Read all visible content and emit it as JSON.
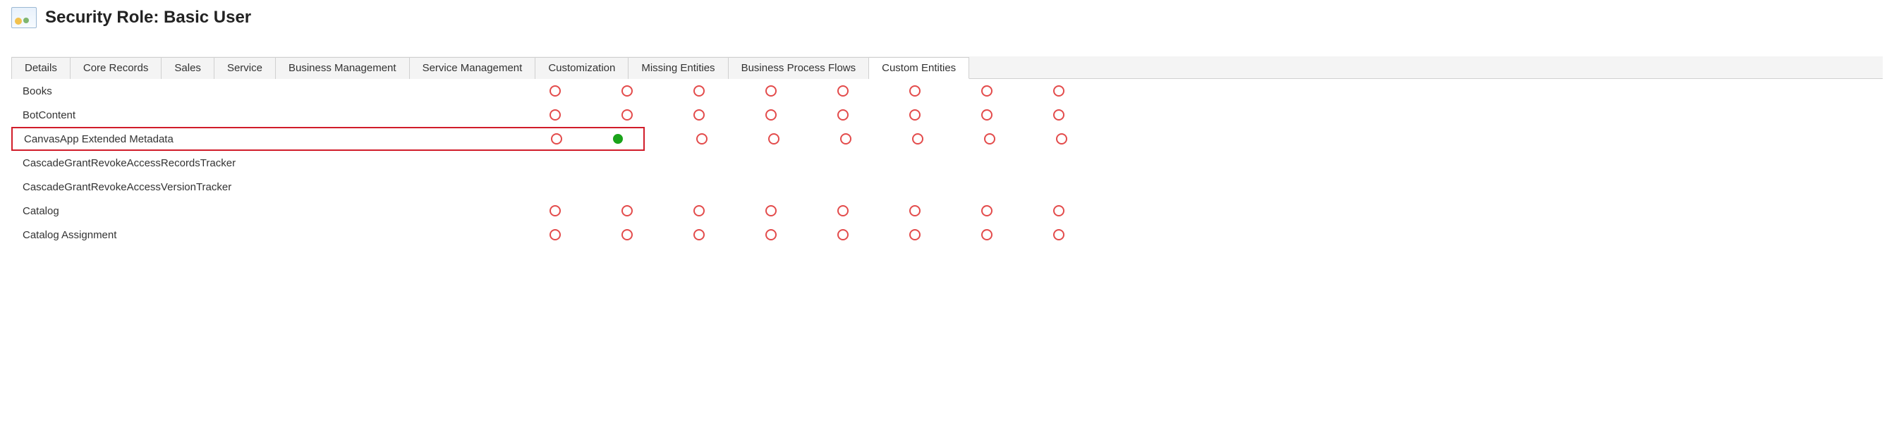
{
  "header": {
    "title": "Security Role: Basic User"
  },
  "tabs": [
    {
      "id": "details",
      "label": "Details",
      "active": false
    },
    {
      "id": "core-records",
      "label": "Core Records",
      "active": false
    },
    {
      "id": "sales",
      "label": "Sales",
      "active": false
    },
    {
      "id": "service",
      "label": "Service",
      "active": false
    },
    {
      "id": "business-management",
      "label": "Business Management",
      "active": false
    },
    {
      "id": "service-management",
      "label": "Service Management",
      "active": false
    },
    {
      "id": "customization",
      "label": "Customization",
      "active": false
    },
    {
      "id": "missing-entities",
      "label": "Missing Entities",
      "active": false
    },
    {
      "id": "business-process-flows",
      "label": "Business Process Flows",
      "active": false
    },
    {
      "id": "custom-entities",
      "label": "Custom Entities",
      "active": true
    }
  ],
  "privilege_states": {
    "none": "none",
    "org": "org"
  },
  "entities": [
    {
      "name": "Books",
      "highlighted": false,
      "privs": [
        "none",
        "none",
        "none",
        "none",
        "none",
        "none",
        "none",
        "none"
      ]
    },
    {
      "name": "BotContent",
      "highlighted": false,
      "privs": [
        "none",
        "none",
        "none",
        "none",
        "none",
        "none",
        "none",
        "none"
      ]
    },
    {
      "name": "CanvasApp Extended Metadata",
      "highlighted": true,
      "privs": [
        "none",
        "org",
        "none",
        "none",
        "none",
        "none",
        "none",
        "none"
      ]
    },
    {
      "name": "CascadeGrantRevokeAccessRecordsTracker",
      "highlighted": false,
      "privs": [
        null,
        null,
        null,
        null,
        null,
        null,
        null,
        null
      ]
    },
    {
      "name": "CascadeGrantRevokeAccessVersionTracker",
      "highlighted": false,
      "privs": [
        null,
        null,
        null,
        null,
        null,
        null,
        null,
        null
      ]
    },
    {
      "name": "Catalog",
      "highlighted": false,
      "privs": [
        "none",
        "none",
        "none",
        "none",
        "none",
        "none",
        "none",
        "none"
      ]
    },
    {
      "name": "Catalog Assignment",
      "highlighted": false,
      "privs": [
        "none",
        "none",
        "none",
        "none",
        "none",
        "none",
        "none",
        "none"
      ]
    }
  ],
  "colors": {
    "priv_ring": "#e34b4b",
    "priv_full": "#1aa31a",
    "highlight_border": "#d11d2a"
  }
}
